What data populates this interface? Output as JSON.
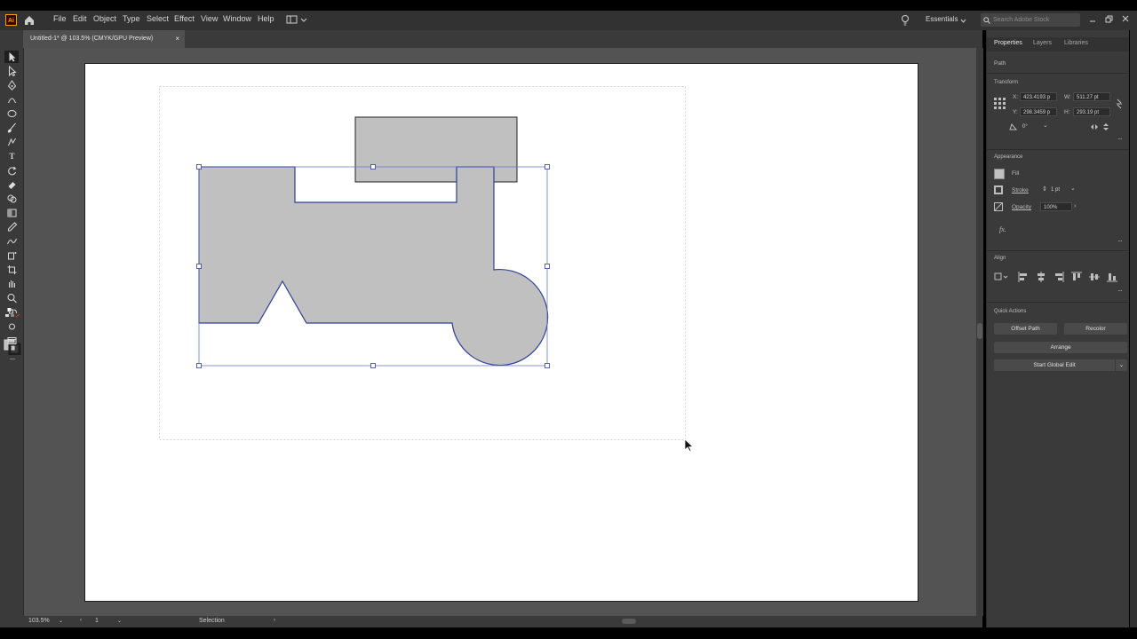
{
  "app": {
    "logo": "Ai"
  },
  "menu": [
    "File",
    "Edit",
    "Object",
    "Type",
    "Select",
    "Effect",
    "View",
    "Window",
    "Help"
  ],
  "header_right": {
    "workspace": "Essentials",
    "search_placeholder": "Search Adobe Stock"
  },
  "document_tab": {
    "title": "Untitled-1* @ 103.5% (CMYK/GPU Preview)",
    "close": "×"
  },
  "statusbar": {
    "zoom": "103.5%",
    "artboard_number": "1",
    "tool": "Selection"
  },
  "panel": {
    "tabs": [
      "Properties",
      "Layers",
      "Libraries"
    ],
    "selection_type": "Path",
    "transform": {
      "heading": "Transform",
      "x_label": "X:",
      "x_value": "423.4193 p",
      "y_label": "Y:",
      "y_value": "298.3459 p",
      "w_label": "W:",
      "w_value": "511.27 pt",
      "h_label": "H:",
      "h_value": "293.19 pt",
      "rotate_value": "0°"
    },
    "appearance": {
      "heading": "Appearance",
      "fill_label": "Fill",
      "stroke_label": "Stroke",
      "stroke_value": "1 pt",
      "opacity_label": "Opacity",
      "opacity_value": "100%",
      "fx": "fx."
    },
    "align": {
      "heading": "Align"
    },
    "quick_actions": {
      "heading": "Quick Actions",
      "offset_path": "Offset Path",
      "recolor": "Recolor",
      "arrange": "Arrange",
      "start_global_edit": "Start Global Edit"
    }
  },
  "colors": {
    "shape_fill": "#c0c0c0",
    "selection_blue": "#2f3f9a",
    "artboard": "#ffffff",
    "pasteboard": "#535353"
  }
}
